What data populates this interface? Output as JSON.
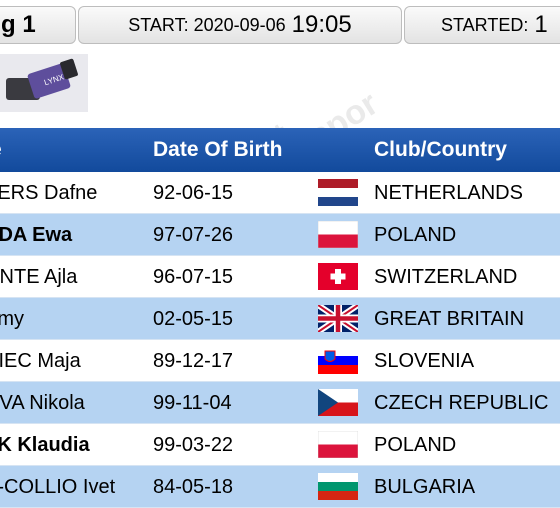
{
  "header": {
    "title": "g 1",
    "start_label": "START: 2020-09-06",
    "start_time": "19:05",
    "started_label": "STARTED:",
    "started_value": "1"
  },
  "logo": {
    "text": "LYNX"
  },
  "table": {
    "columns": {
      "name": "e",
      "dob": "Date Of Birth",
      "club": "Club/Country"
    },
    "rows": [
      {
        "name": "PERS Dafne",
        "bold": false,
        "dob": "92-06-15",
        "flag": "netherlands-flag-icon",
        "country": "NETHERLANDS"
      },
      {
        "name": "DDA Ewa",
        "bold": true,
        "dob": "97-07-26",
        "flag": "poland-flag-icon",
        "country": "POLAND"
      },
      {
        "name": "ONTE Ajla",
        "bold": false,
        "dob": "96-07-15",
        "flag": "switzerland-flag-icon",
        "country": "SWITZERLAND"
      },
      {
        "name": "Amy",
        "bold": false,
        "dob": "02-05-15",
        "flag": "great-britain-flag-icon",
        "country": "GREAT BRITAIN"
      },
      {
        "name": "NIEC Maja",
        "bold": false,
        "dob": "89-12-17",
        "flag": "slovenia-flag-icon",
        "country": "SLOVENIA"
      },
      {
        "name": "OVA Nikola",
        "bold": false,
        "dob": "99-11-04",
        "flag": "czech-flag-icon",
        "country": "CZECH REPUBLIC"
      },
      {
        "name": "EK Klaudia",
        "bold": true,
        "dob": "99-03-22",
        "flag": "poland-flag-icon",
        "country": "POLAND"
      },
      {
        "name": "A-COLLIO Ivet",
        "bold": false,
        "dob": "84-05-18",
        "flag": "bulgaria-flag-icon",
        "country": "BULGARIA"
      }
    ]
  },
  "colors": {
    "header_blue": "#1a56ab",
    "row_alt": "#b5d3f2"
  }
}
